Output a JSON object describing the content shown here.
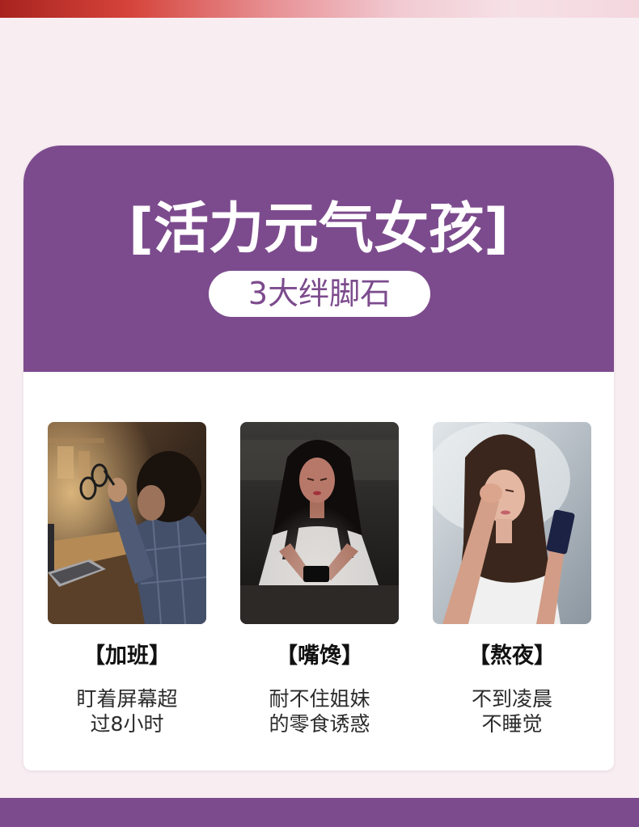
{
  "colors": {
    "accent": "#7c4b8d",
    "page_bg": "#f8eef2",
    "card_bg": "#ffffff"
  },
  "header": {
    "title": "[活力元气女孩]",
    "subtitle": "3大绊脚石"
  },
  "obstacles": [
    {
      "label": "【加班】",
      "desc_line1": "盯着屏幕超",
      "desc_line2": "过8小时"
    },
    {
      "label": "【嘴馋】",
      "desc_line1": "耐不住姐妹",
      "desc_line2": "的零食诱惑"
    },
    {
      "label": "【熬夜】",
      "desc_line1": "不到凌晨",
      "desc_line2": "不睡觉"
    }
  ]
}
